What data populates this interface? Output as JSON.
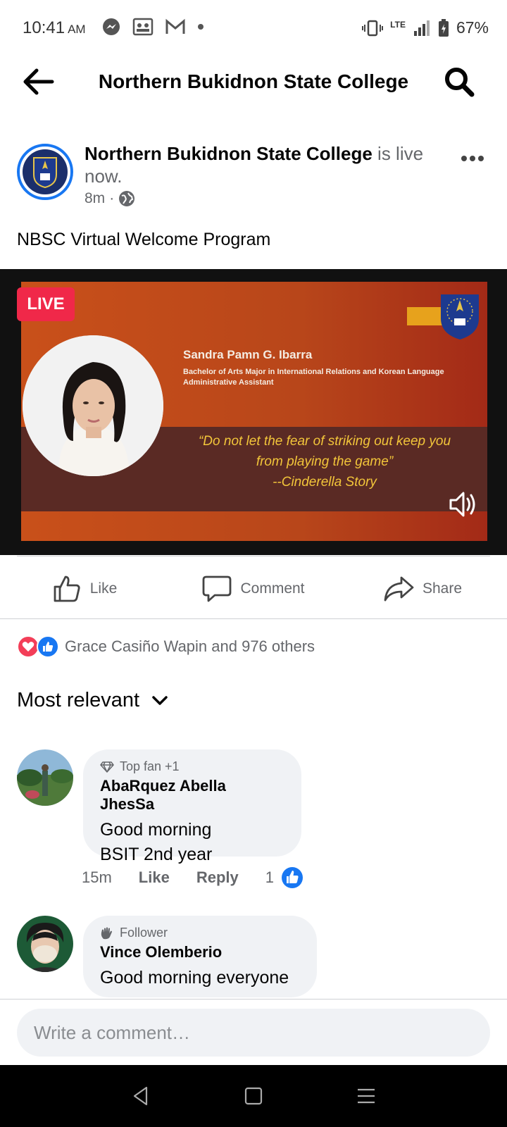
{
  "status": {
    "time": "10:41",
    "ampm": "AM",
    "battery": "67%",
    "network": "LTE"
  },
  "header": {
    "title": "Northern Bukidnon State College"
  },
  "post": {
    "author": "Northern Bukidnon State College",
    "status_text": " is live now.",
    "time": "8m",
    "separator": "·",
    "text": "NBSC Virtual Welcome Program",
    "live_label": "LIVE",
    "slide": {
      "speaker_name": "Sandra Pamn G. Ibarra",
      "speaker_degree": "Bachelor of Arts Major in International Relations and Korean Language",
      "speaker_role": "Administrative Assistant",
      "quote_line1": "“Do not let the fear of striking out keep you",
      "quote_line2": "from playing the game”",
      "quote_source": "--Cinderella Story"
    }
  },
  "actions": {
    "like": "Like",
    "comment": "Comment",
    "share": "Share"
  },
  "reactions": {
    "summary": "Grace Casiño Wapin and 976 others"
  },
  "sort": {
    "label": "Most relevant"
  },
  "comments": [
    {
      "badge": "Top fan +1",
      "name": "AbaRquez Abella JhesSa",
      "line1": "Good morning",
      "line2": "BSIT 2nd year",
      "time": "15m",
      "like": "Like",
      "reply": "Reply",
      "likes": "1"
    },
    {
      "badge": "Follower",
      "name": "Vince Olemberio",
      "line1": "Good morning everyone"
    }
  ],
  "composer": {
    "placeholder": "Write a comment…"
  },
  "colors": {
    "brand_blue": "#1877f2",
    "live_red": "#f02849",
    "bubble_gray": "#f0f2f5"
  }
}
